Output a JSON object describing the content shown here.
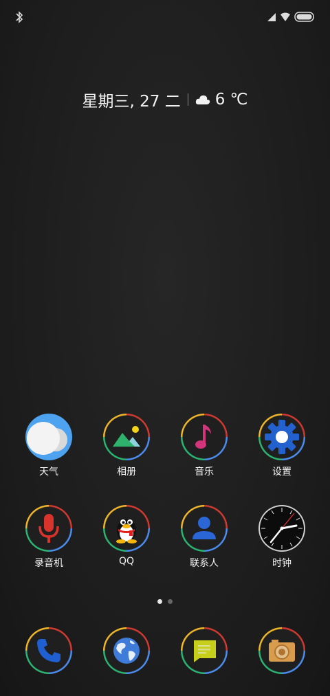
{
  "status_bar": {
    "left_icons": [
      "bluetooth-icon"
    ],
    "right_icons": [
      "signal-icon",
      "wifi-icon",
      "battery-icon"
    ]
  },
  "date_widget": {
    "date": "星期三, 27 二",
    "weather_icon": "cloud-icon",
    "temperature": "6 ℃"
  },
  "apps": [
    {
      "id": "weather",
      "label": "天气",
      "icon": "weather-icon"
    },
    {
      "id": "gallery",
      "label": "相册",
      "icon": "gallery-icon"
    },
    {
      "id": "music",
      "label": "音乐",
      "icon": "music-icon"
    },
    {
      "id": "settings",
      "label": "设置",
      "icon": "gear-icon"
    },
    {
      "id": "recorder",
      "label": "录音机",
      "icon": "microphone-icon"
    },
    {
      "id": "qq",
      "label": "QQ",
      "icon": "qq-penguin-icon"
    },
    {
      "id": "contacts",
      "label": "联系人",
      "icon": "contact-icon"
    },
    {
      "id": "clock",
      "label": "时钟",
      "icon": "clock-icon"
    }
  ],
  "page_indicator": {
    "pages": 2,
    "current": 1
  },
  "dock": [
    {
      "id": "phone",
      "icon": "phone-icon"
    },
    {
      "id": "browser",
      "icon": "globe-icon"
    },
    {
      "id": "messages",
      "icon": "message-icon"
    },
    {
      "id": "camera",
      "icon": "camera-icon"
    }
  ],
  "colors": {
    "background": "#1e1e1e",
    "ring_red": "#d13a31",
    "ring_blue": "#4b8ef0",
    "ring_green": "#2bb673",
    "ring_yellow": "#f0b82a"
  }
}
